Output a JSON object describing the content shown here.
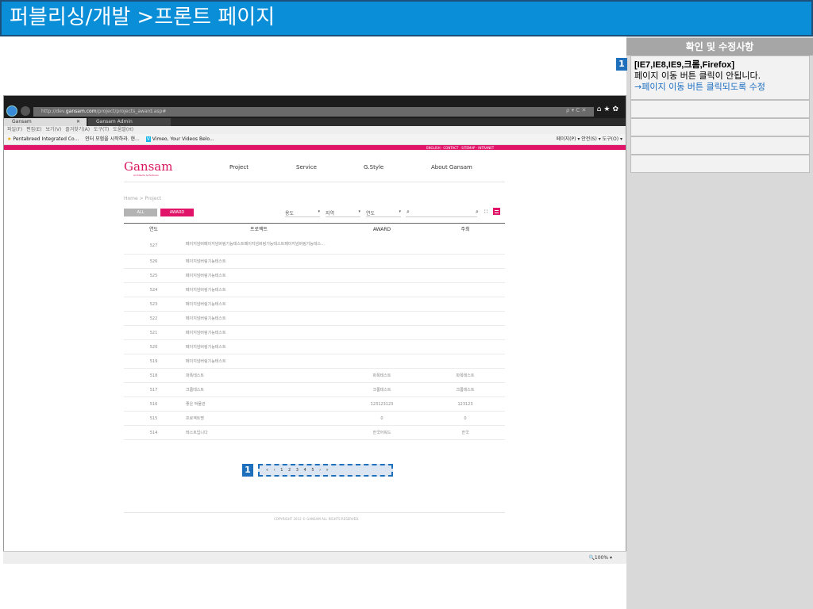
{
  "header": {
    "title": "퍼블리싱/개발 >프론트 페이지"
  },
  "side": {
    "title": "확인 및 수정사항",
    "notes": [
      {
        "num": "1",
        "line1": "[IE7,IE8,IE9,크롬,Firefox]",
        "line2": "페이지 이동 버튼 클릭이 안됩니다.",
        "line3": "→페이지 이동 버튼 클릭되도록 수정"
      }
    ]
  },
  "browser": {
    "url_prefix": "http://dev.",
    "url_host": "gansam.com",
    "url_path": "/project/projects_award.asp#",
    "url_icons": "ρ ▾ C ✕",
    "tab1": "Gansam",
    "tab1_close": "✕",
    "tab2": "Gansam Admin",
    "menu": "파일(F)  편집(E)  보기(V)  즐겨찾기(A)  도구(T)  도움말(H)",
    "favorites": [
      "Pentabreed Integrated Co...",
      "인터 모험을 시작하라. 현...",
      "Vimeo, Your Videos Belo..."
    ],
    "tools": "페이지(P) ▾  안전(S) ▾  도구(O) ▾",
    "zoom": "100%"
  },
  "site": {
    "top_links": "ENGLISH · CONTACT · SITEMAP · INTRANET",
    "logo": "Gansam",
    "logo_sub": "Architects & Partners",
    "nav": [
      "Project",
      "Service",
      "G.Style",
      "About Gansam"
    ],
    "breadcrumb": "Home > Project",
    "filters": {
      "all": "ALL",
      "award": "AWARD"
    },
    "selects": [
      "용도",
      "지역",
      "연도"
    ],
    "select_arrow": "▾",
    "columns": [
      "연도",
      "프로젝트",
      "AWARD",
      "주최"
    ],
    "rows": [
      {
        "no": "527",
        "project": "페이지넘버페이지넘버링기능테스트페이지넘버링기능테스트페이지넘버링기능테스...",
        "award": "",
        "host": ""
      },
      {
        "no": "526",
        "project": "페이지넘버링기능테스트",
        "award": "",
        "host": ""
      },
      {
        "no": "525",
        "project": "페이지넘버링기능테스트",
        "award": "",
        "host": ""
      },
      {
        "no": "524",
        "project": "페이지넘버링기능테스트",
        "award": "",
        "host": ""
      },
      {
        "no": "523",
        "project": "페이지넘버링기능테스트",
        "award": "",
        "host": ""
      },
      {
        "no": "522",
        "project": "페이지넘버링기능테스트",
        "award": "",
        "host": ""
      },
      {
        "no": "521",
        "project": "페이지넘버링기능테스트",
        "award": "",
        "host": ""
      },
      {
        "no": "520",
        "project": "페이지넘버링기능테스트",
        "award": "",
        "host": ""
      },
      {
        "no": "519",
        "project": "페이지넘버링기능테스트",
        "award": "",
        "host": ""
      },
      {
        "no": "518",
        "project": "파폭테스트",
        "award": "파폭테스트",
        "host": "파폭테스트"
      },
      {
        "no": "517",
        "project": "크롬테스트",
        "award": "크롬테스트",
        "host": "크롬테스트"
      },
      {
        "no": "516",
        "project": "좋은 박물관",
        "award": "123123123",
        "host": "123123"
      },
      {
        "no": "515",
        "project": "프로젝트명",
        "award": "0",
        "host": "0"
      },
      {
        "no": "514",
        "project": "테스트입니다",
        "award": "한국어워드",
        "host": "한국"
      }
    ],
    "pagination": "« ‹   1 2 3 4 5   › »",
    "pagination_badge": "1",
    "copyright": "COPYRIGHT 2012 © GANSAM ALL RIGHTS RESERVED."
  }
}
